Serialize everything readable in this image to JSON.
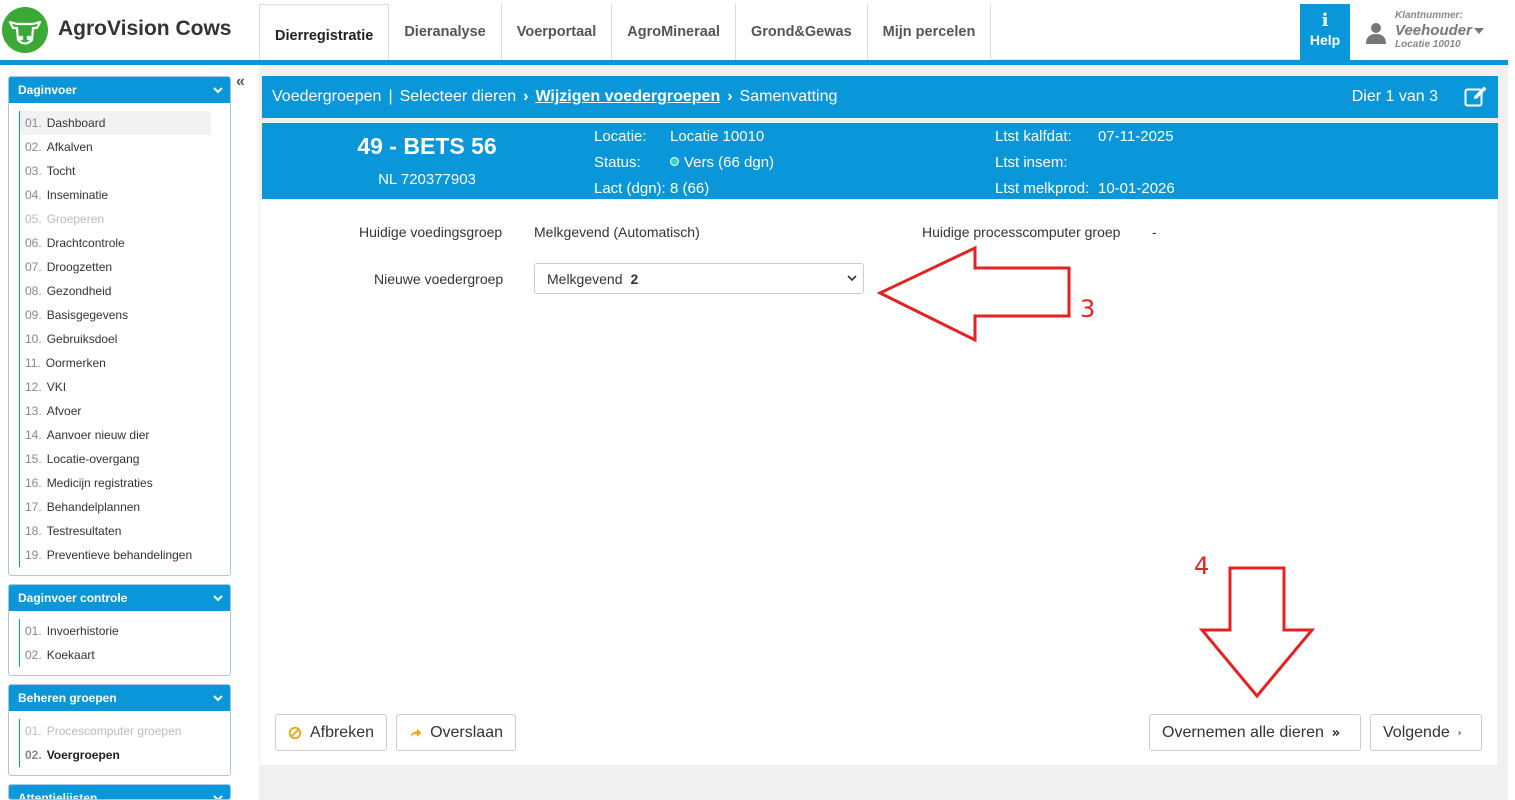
{
  "app": {
    "brand": "AgroVision Cows",
    "accent": "#0a97d9",
    "logo_color": "#3aa935"
  },
  "tabs": [
    {
      "label": "Dierregistratie",
      "active": true
    },
    {
      "label": "Dieranalyse"
    },
    {
      "label": "Voerportaal"
    },
    {
      "label": "AgroMineraal"
    },
    {
      "label": "Grond&Gewas"
    },
    {
      "label": "Mijn percelen"
    }
  ],
  "help": {
    "icon": "info-icon",
    "label": "Help"
  },
  "user": {
    "klantnummer_label": "Klantnummer:",
    "name": "Veehouder",
    "location": "Locatie 10010",
    "icon": "user-icon"
  },
  "sidebar": {
    "panels": [
      {
        "title": "Daginvoer",
        "items": [
          {
            "num": "01.",
            "label": "Dashboard",
            "selected": true
          },
          {
            "num": "02.",
            "label": "Afkalven"
          },
          {
            "num": "03.",
            "label": "Tocht"
          },
          {
            "num": "04.",
            "label": "Inseminatie"
          },
          {
            "num": "05.",
            "label": "Groeperen",
            "disabled": true
          },
          {
            "num": "06.",
            "label": "Drachtcontrole"
          },
          {
            "num": "07.",
            "label": "Droogzetten"
          },
          {
            "num": "08.",
            "label": "Gezondheid"
          },
          {
            "num": "09.",
            "label": "Basisgegevens"
          },
          {
            "num": "10.",
            "label": "Gebruiksdoel"
          },
          {
            "num": "11.",
            "label": "Oormerken"
          },
          {
            "num": "12.",
            "label": "VKI"
          },
          {
            "num": "13.",
            "label": "Afvoer"
          },
          {
            "num": "14.",
            "label": "Aanvoer nieuw dier"
          },
          {
            "num": "15.",
            "label": "Locatie-overgang"
          },
          {
            "num": "16.",
            "label": "Medicijn registraties"
          },
          {
            "num": "17.",
            "label": "Behandelplannen"
          },
          {
            "num": "18.",
            "label": "Testresultaten"
          },
          {
            "num": "19.",
            "label": "Preventieve behandelingen"
          }
        ]
      },
      {
        "title": "Daginvoer controle",
        "items": [
          {
            "num": "01.",
            "label": "Invoerhistorie"
          },
          {
            "num": "02.",
            "label": "Koekaart"
          }
        ]
      },
      {
        "title": "Beheren groepen",
        "items": [
          {
            "num": "01.",
            "label": "Procescomputer groepen",
            "disabled": true
          },
          {
            "num": "02.",
            "label": "Voergroepen",
            "active": true
          }
        ]
      },
      {
        "title": "Attentielijsten"
      }
    ]
  },
  "wizard": {
    "steps": [
      "Voedergroepen",
      "Selecteer dieren",
      "Wijzigen voedergroepen",
      "Samenvatting"
    ],
    "current_step": "Wijzigen voedergroepen",
    "counter": "Dier 1 van 3",
    "edit_icon": "edit-icon"
  },
  "animal": {
    "name": "49 - BETS 56",
    "id": "NL 720377903",
    "locatie_label": "Locatie:",
    "locatie_value": "Locatie 10010",
    "status_label": "Status:",
    "status_value": "Vers (66 dgn)",
    "lact_label": "Lact (dgn):",
    "lact_value": "8 (66)",
    "kalf_label": "Ltst kalfdat:",
    "kalf_value": "07-11-2025",
    "insem_label": "Ltst insem:",
    "insem_value": "",
    "melk_label": "Ltst melkprod:",
    "melk_value": "10-01-2026"
  },
  "form": {
    "current_group_label": "Huidige voedingsgroep",
    "current_group_value": "Melkgevend (Automatisch)",
    "pc_group_label": "Huidige processcomputer groep",
    "pc_group_value": "-",
    "new_group_label": "Nieuwe voedergroep",
    "new_group_value": "Melkgevend",
    "new_group_num": "2"
  },
  "buttons": {
    "cancel": "Afbreken",
    "skip": "Overslaan",
    "apply_all": "Overnemen alle dieren",
    "next": "Volgende"
  },
  "annotations": {
    "arrow_3": "3",
    "arrow_4": "4",
    "color": "#e52222"
  }
}
